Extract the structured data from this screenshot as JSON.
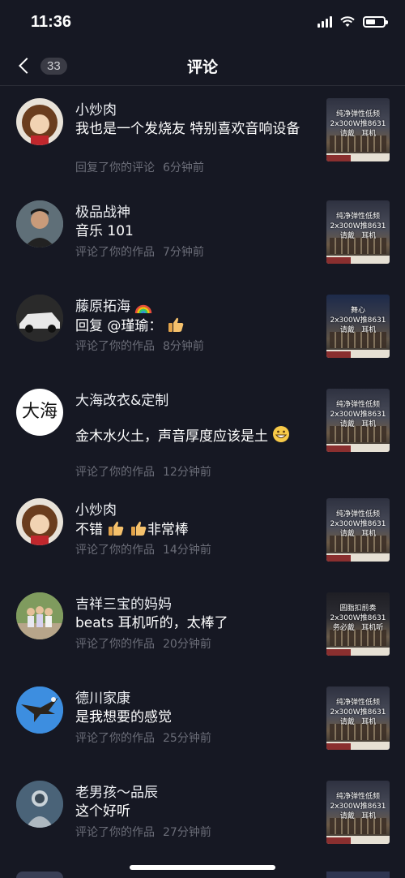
{
  "status": {
    "time": "11:36"
  },
  "nav": {
    "title": "评论",
    "count": "33"
  },
  "comments": [
    {
      "user": "小炒肉",
      "text": "我也是一个发烧友 特别喜欢音响设备",
      "action": "回复了你的评论",
      "time": "6分钟前",
      "thumb": "纯净弹性低频\n2x300W推8631\n请戴   耳机"
    },
    {
      "user": "极品战神",
      "text": "音乐 101",
      "action": "评论了你的作品",
      "time": "7分钟前",
      "thumb": "纯净弹性低频\n2x300W推8631\n请戴   耳机"
    },
    {
      "user": "藤原拓海",
      "text": "回复 @瑾瑜：",
      "action": "评论了你的作品",
      "time": "8分钟前",
      "thumb": "舞心\n2x300W推8631\n请戴   耳机"
    },
    {
      "user": "大海改衣&定制",
      "text": "金木水火土，声音厚度应该是土",
      "action": "评论了你的作品",
      "time": "12分钟前",
      "thumb": "纯净弹性低频\n2x300W推8631\n请戴   耳机"
    },
    {
      "user": "小炒肉",
      "text": "不错",
      "text_suffix": "非常棒",
      "action": "评论了你的作品",
      "time": "14分钟前",
      "thumb": "纯净弹性低频\n2x300W推8631\n请戴   耳机"
    },
    {
      "user": "吉祥三宝的妈妈",
      "text": "beats 耳机听的，太棒了",
      "action": "评论了你的作品",
      "time": "20分钟前",
      "thumb": "圆脂扣前奏\n2x300W推8631\n务必戴   耳机听"
    },
    {
      "user": "德川家康",
      "text": "是我想要的感觉",
      "action": "评论了你的作品",
      "time": "25分钟前",
      "thumb": "纯净弹性低频\n2x300W推8631\n请戴   耳机"
    },
    {
      "user": "老男孩～品辰",
      "text": "这个好听",
      "action": "评论了你的作品",
      "time": "27分钟前",
      "thumb": "纯净弹性低频\n2x300W推8631\n请戴   耳机"
    }
  ],
  "avatar_text": {
    "dahai": "大海"
  }
}
